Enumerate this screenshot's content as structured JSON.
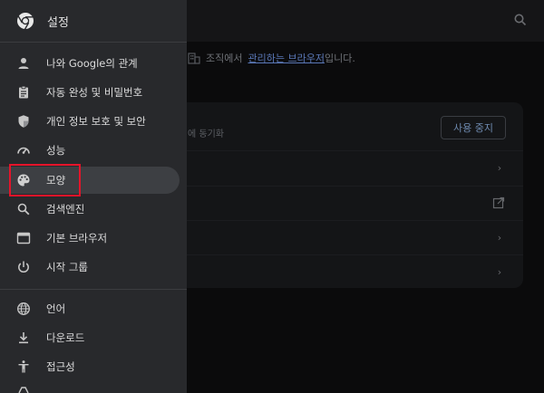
{
  "drawer": {
    "title": "설정",
    "items_top": [
      {
        "label": "나와 Google의 관계",
        "icon": "person-icon"
      },
      {
        "label": "자동 완성 및 비밀번호",
        "icon": "clipboard-icon"
      },
      {
        "label": "개인 정보 보호 및 보안",
        "icon": "shield-icon"
      },
      {
        "label": "성능",
        "icon": "speedometer-icon"
      },
      {
        "label": "모양",
        "icon": "palette-icon"
      },
      {
        "label": "검색엔진",
        "icon": "search-icon"
      },
      {
        "label": "기본 브라우저",
        "icon": "browser-window-icon"
      },
      {
        "label": "시작 그룹",
        "icon": "power-icon"
      }
    ],
    "items_bottom": [
      {
        "label": "언어",
        "icon": "globe-icon"
      },
      {
        "label": "다운로드",
        "icon": "download-icon"
      },
      {
        "label": "접근성",
        "icon": "accessibility-icon"
      }
    ],
    "active_label": "모양"
  },
  "background": {
    "managed_prefix": "조직에서",
    "managed_link": "관리하는 브라우저",
    "managed_suffix": "입니다.",
    "sync_text": "에 동기화",
    "sync_button": "사용 중지"
  },
  "colors": {
    "drawer_bg": "#28292c",
    "active_bg": "#3d3f43",
    "highlight": "#e5142a",
    "link": "#5a78b8"
  }
}
